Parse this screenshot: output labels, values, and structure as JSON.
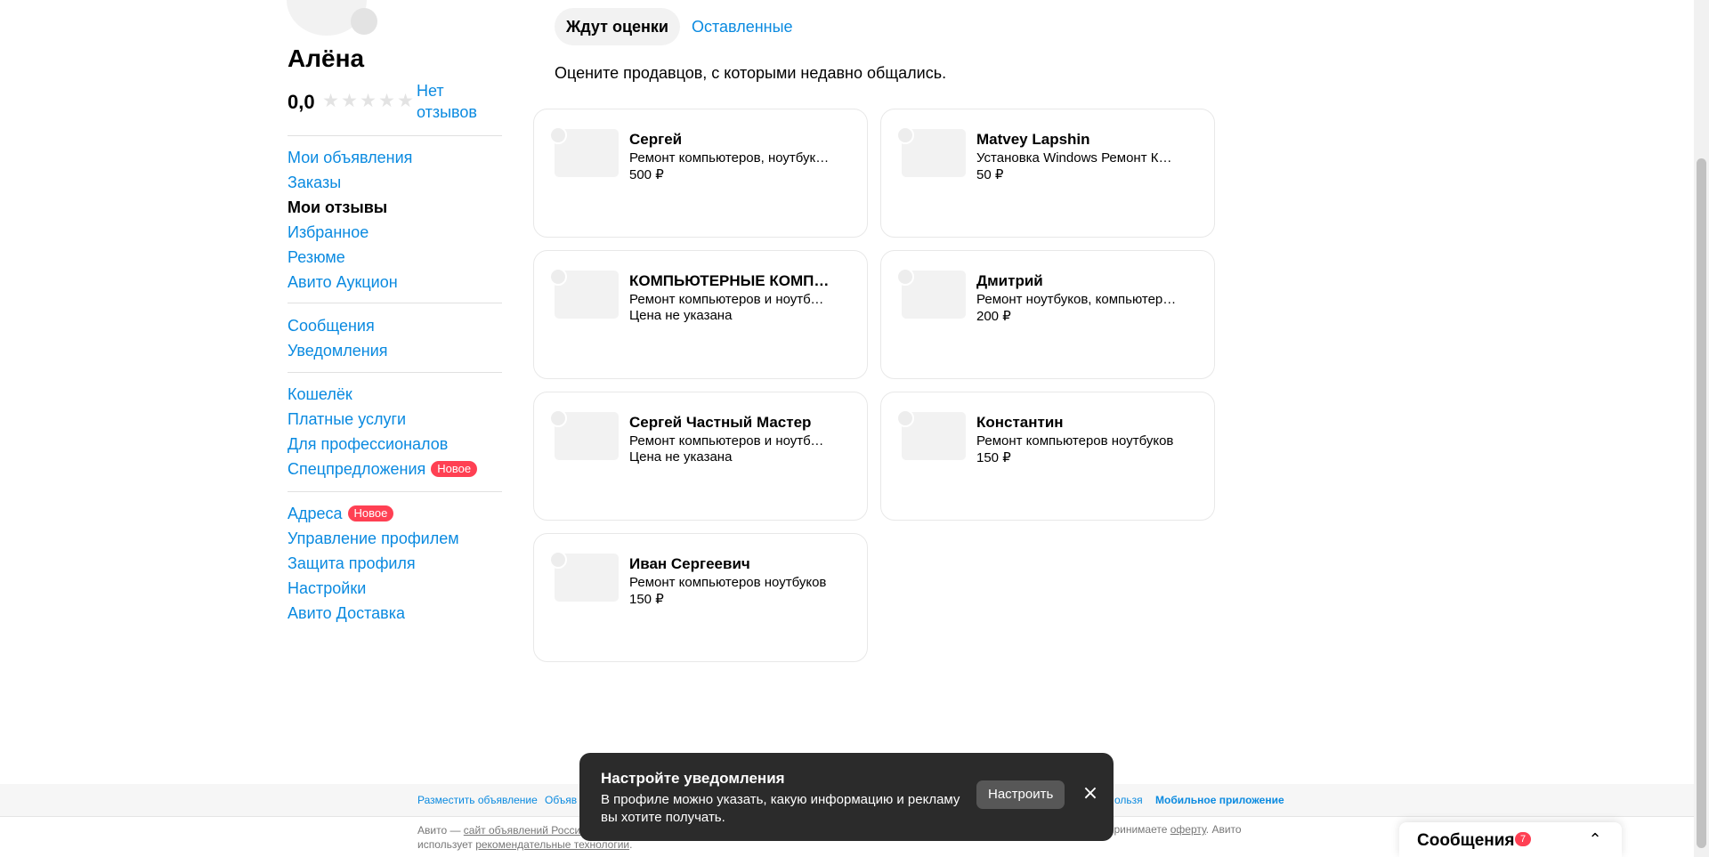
{
  "profile": {
    "name": "Алёна",
    "rating": "0,0",
    "no_reviews": "Нет отзывов"
  },
  "sidebar": {
    "group1": [
      "Мои объявления",
      "Заказы",
      "Мои отзывы",
      "Избранное",
      "Резюме",
      "Авито Аукцион"
    ],
    "group2": [
      "Сообщения",
      "Уведомления"
    ],
    "group3": [
      "Кошелёк",
      "Платные услуги",
      "Для профессионалов",
      "Спецпредложения"
    ],
    "group4": [
      "Адреса",
      "Управление профилем",
      "Защита профиля",
      "Настройки",
      "Авито Доставка"
    ],
    "badge_new": "Новое"
  },
  "tabs": {
    "awaiting": "Ждут оценки",
    "left": "Оставленные"
  },
  "hint": "Оцените продавцов, с которыми недавно общались.",
  "cards": [
    {
      "name": "Сергей",
      "desc": "Ремонт компьютеров, ноутбуков",
      "price": "500 ₽"
    },
    {
      "name": "Matvey Lapshin",
      "desc": "Установка Windows Ремонт Компьютеров",
      "price": "50 ₽"
    },
    {
      "name": "КОМПЬЮТЕРНЫЕ КОМПЛЕКТУЮЩИЕ",
      "desc": "Ремонт компьютеров и ноутбуков",
      "price": "Цена не указана"
    },
    {
      "name": "Дмитрий",
      "desc": "Ремонт ноутбуков, компьютеров",
      "price": "200 ₽"
    },
    {
      "name": "Сергей Частный Мастер",
      "desc": "Ремонт компьютеров и ноутбуков",
      "price": "Цена не указана"
    },
    {
      "name": "Константин",
      "desc": "Ремонт компьютеров ноутбуков",
      "price": "150 ₽"
    },
    {
      "name": "Иван Сергеевич",
      "desc": "Ремонт компьютеров ноутбуков",
      "price": "150 ₽"
    }
  ],
  "footer": {
    "link_post": "Разместить объявление",
    "link_ads": "Объяв",
    "link_rules": "ользя",
    "link_mobile": "Мобильное приложение",
    "legal_prefix": "Авито — ",
    "legal_link": "сайт объявлений России",
    "legal_line2_prefix": "использует ",
    "legal_line2_link": "рекомендательные технологии",
    "legal_line2_suffix": ".",
    "legal_right_prefix": "ы принимаете ",
    "legal_right_link": "оферту",
    "legal_right_suffix": ". Авито"
  },
  "toast": {
    "title": "Настройте уведомления",
    "text": "В профиле можно указать, какую информацию и рекламу вы хотите получать.",
    "button": "Настроить"
  },
  "messages": {
    "label": "Сообщения",
    "count": "7"
  },
  "colors": {
    "link": "#0a8ae0",
    "badge": "#ff4053",
    "toast_bg": "#2b2b2b"
  }
}
